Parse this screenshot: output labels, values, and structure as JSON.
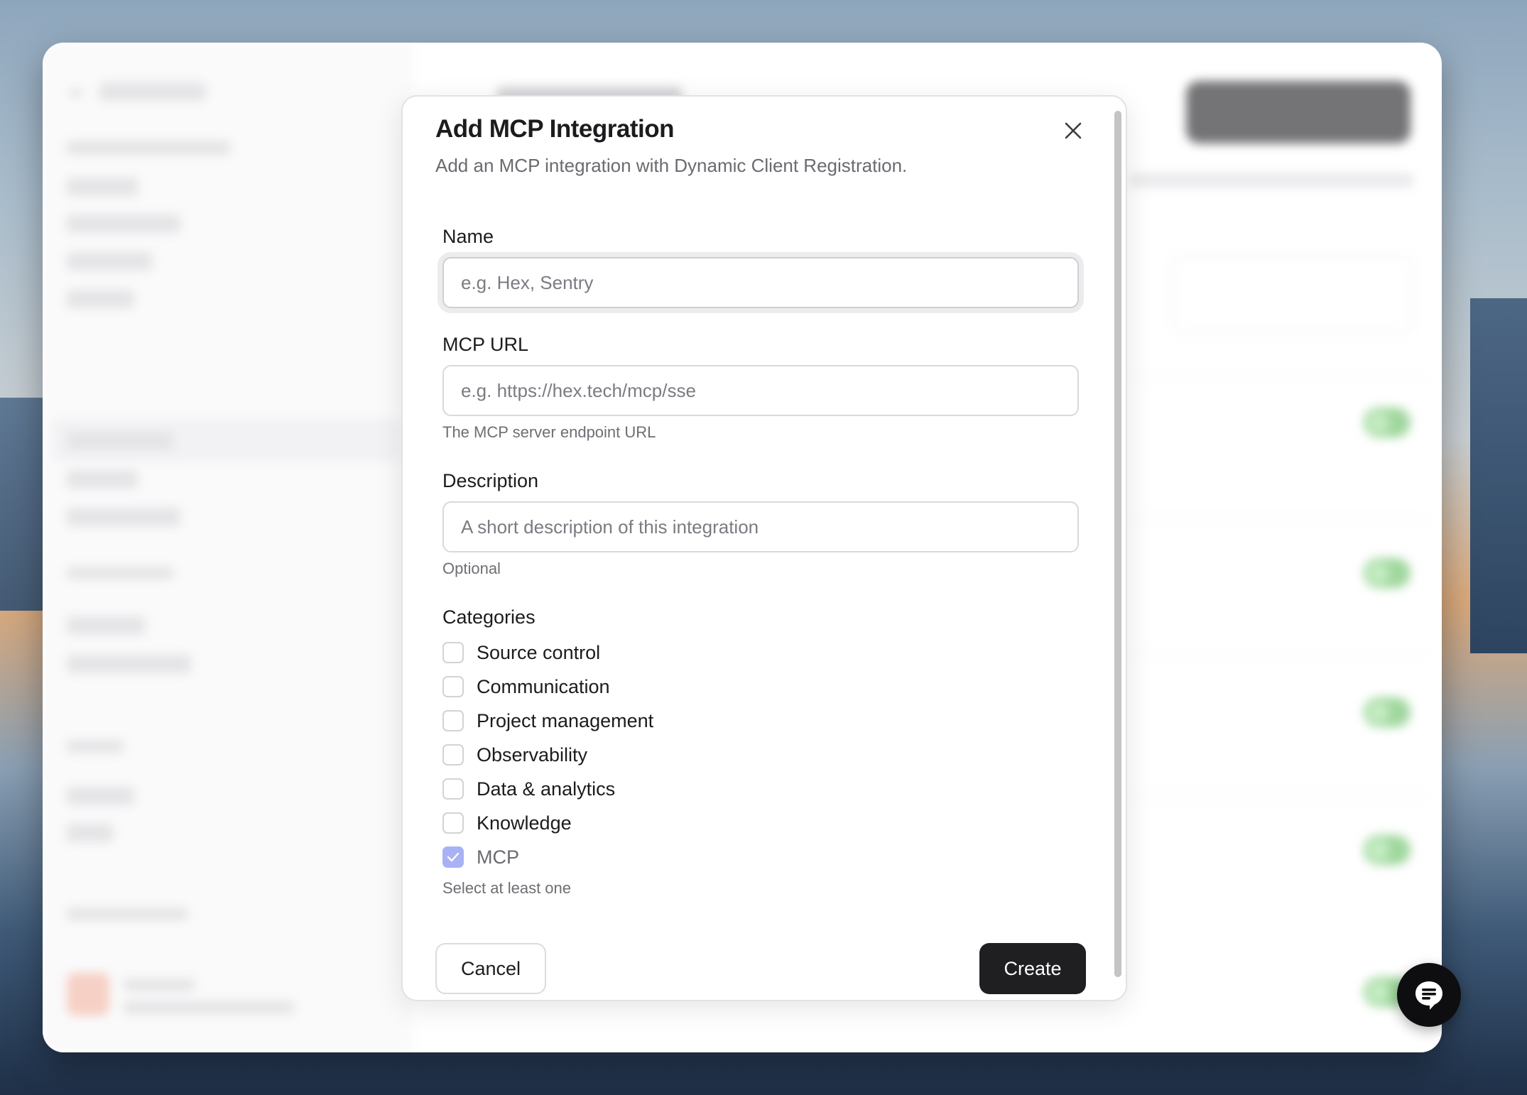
{
  "modal": {
    "title": "Add MCP Integration",
    "subtitle": "Add an MCP integration with Dynamic Client Registration.",
    "close_icon": "close-icon"
  },
  "form": {
    "name": {
      "label": "Name",
      "placeholder": "e.g. Hex, Sentry",
      "value": ""
    },
    "mcp_url": {
      "label": "MCP URL",
      "placeholder": "e.g. https://hex.tech/mcp/sse",
      "value": "",
      "hint": "The MCP server endpoint URL"
    },
    "description": {
      "label": "Description",
      "placeholder": "A short description of this integration",
      "value": "",
      "hint": "Optional"
    },
    "categories": {
      "label": "Categories",
      "items": [
        {
          "label": "Source control",
          "checked": false
        },
        {
          "label": "Communication",
          "checked": false
        },
        {
          "label": "Project management",
          "checked": false
        },
        {
          "label": "Observability",
          "checked": false
        },
        {
          "label": "Data & analytics",
          "checked": false
        },
        {
          "label": "Knowledge",
          "checked": false
        },
        {
          "label": "MCP",
          "checked": true
        }
      ],
      "hint": "Select at least one"
    }
  },
  "actions": {
    "cancel_label": "Cancel",
    "create_label": "Create"
  },
  "colors": {
    "primary_button": "#1f1f22",
    "checkbox_checked": "#a9b1f5",
    "toggle_on": "#6dc26a"
  },
  "chat_fab": {
    "icon": "chat-bubble-icon"
  }
}
